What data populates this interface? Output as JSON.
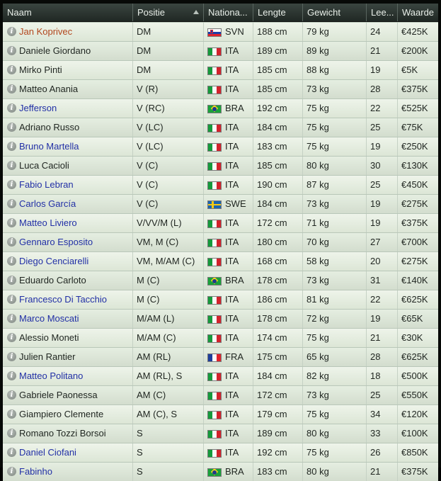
{
  "columns": [
    "Naam",
    "Positie",
    "Nationa...",
    "Lengte",
    "Gewicht",
    "Lee...",
    "Waarde"
  ],
  "sort_column": "Positie",
  "rows": [
    {
      "name": "Jan Koprivec",
      "pos": "DM",
      "flag": "svn",
      "nat": "SVN",
      "len": "188 cm",
      "wt": "79 kg",
      "age": "24",
      "val": "€425K",
      "style": "sel"
    },
    {
      "name": "Daniele Giordano",
      "pos": "DM",
      "flag": "ita",
      "nat": "ITA",
      "len": "189 cm",
      "wt": "89 kg",
      "age": "21",
      "val": "€200K",
      "style": "plain"
    },
    {
      "name": "Mirko Pinti",
      "pos": "DM",
      "flag": "ita",
      "nat": "ITA",
      "len": "185 cm",
      "wt": "88 kg",
      "age": "19",
      "val": "€5K",
      "style": "plain"
    },
    {
      "name": "Matteo Anania",
      "pos": "V (R)",
      "flag": "ita",
      "nat": "ITA",
      "len": "185 cm",
      "wt": "73 kg",
      "age": "28",
      "val": "€375K",
      "style": "plain"
    },
    {
      "name": "Jefferson",
      "pos": "V (RC)",
      "flag": "bra",
      "nat": "BRA",
      "len": "192 cm",
      "wt": "75 kg",
      "age": "22",
      "val": "€525K",
      "style": "link"
    },
    {
      "name": "Adriano Russo",
      "pos": "V (LC)",
      "flag": "ita",
      "nat": "ITA",
      "len": "184 cm",
      "wt": "75 kg",
      "age": "25",
      "val": "€75K",
      "style": "plain"
    },
    {
      "name": "Bruno Martella",
      "pos": "V (LC)",
      "flag": "ita",
      "nat": "ITA",
      "len": "183 cm",
      "wt": "75 kg",
      "age": "19",
      "val": "€250K",
      "style": "link"
    },
    {
      "name": "Luca Cacioli",
      "pos": "V (C)",
      "flag": "ita",
      "nat": "ITA",
      "len": "185 cm",
      "wt": "80 kg",
      "age": "30",
      "val": "€130K",
      "style": "plain"
    },
    {
      "name": "Fabio Lebran",
      "pos": "V (C)",
      "flag": "ita",
      "nat": "ITA",
      "len": "190 cm",
      "wt": "87 kg",
      "age": "25",
      "val": "€450K",
      "style": "link"
    },
    {
      "name": "Carlos García",
      "pos": "V (C)",
      "flag": "swe",
      "nat": "SWE",
      "len": "184 cm",
      "wt": "73 kg",
      "age": "19",
      "val": "€275K",
      "style": "link"
    },
    {
      "name": "Matteo Liviero",
      "pos": "V/VV/M (L)",
      "flag": "ita",
      "nat": "ITA",
      "len": "172 cm",
      "wt": "71 kg",
      "age": "19",
      "val": "€375K",
      "style": "link"
    },
    {
      "name": "Gennaro Esposito",
      "pos": "VM, M (C)",
      "flag": "ita",
      "nat": "ITA",
      "len": "180 cm",
      "wt": "70 kg",
      "age": "27",
      "val": "€700K",
      "style": "link"
    },
    {
      "name": "Diego Cenciarelli",
      "pos": "VM, M/AM (C)",
      "flag": "ita",
      "nat": "ITA",
      "len": "168 cm",
      "wt": "58 kg",
      "age": "20",
      "val": "€275K",
      "style": "link"
    },
    {
      "name": "Eduardo Carloto",
      "pos": "M (C)",
      "flag": "bra",
      "nat": "BRA",
      "len": "178 cm",
      "wt": "73 kg",
      "age": "31",
      "val": "€140K",
      "style": "plain"
    },
    {
      "name": "Francesco Di Tacchio",
      "pos": "M (C)",
      "flag": "ita",
      "nat": "ITA",
      "len": "186 cm",
      "wt": "81 kg",
      "age": "22",
      "val": "€625K",
      "style": "link"
    },
    {
      "name": "Marco Moscati",
      "pos": "M/AM (L)",
      "flag": "ita",
      "nat": "ITA",
      "len": "178 cm",
      "wt": "72 kg",
      "age": "19",
      "val": "€65K",
      "style": "link"
    },
    {
      "name": "Alessio Moneti",
      "pos": "M/AM (C)",
      "flag": "ita",
      "nat": "ITA",
      "len": "174 cm",
      "wt": "75 kg",
      "age": "21",
      "val": "€30K",
      "style": "plain"
    },
    {
      "name": "Julien Rantier",
      "pos": "AM (RL)",
      "flag": "fra",
      "nat": "FRA",
      "len": "175 cm",
      "wt": "65 kg",
      "age": "28",
      "val": "€625K",
      "style": "plain"
    },
    {
      "name": "Matteo Politano",
      "pos": "AM (RL), S",
      "flag": "ita",
      "nat": "ITA",
      "len": "184 cm",
      "wt": "82 kg",
      "age": "18",
      "val": "€500K",
      "style": "link"
    },
    {
      "name": "Gabriele Paonessa",
      "pos": "AM (C)",
      "flag": "ita",
      "nat": "ITA",
      "len": "172 cm",
      "wt": "73 kg",
      "age": "25",
      "val": "€550K",
      "style": "plain"
    },
    {
      "name": "Giampiero Clemente",
      "pos": "AM (C), S",
      "flag": "ita",
      "nat": "ITA",
      "len": "179 cm",
      "wt": "75 kg",
      "age": "34",
      "val": "€120K",
      "style": "plain"
    },
    {
      "name": "Romano Tozzi Borsoi",
      "pos": "S",
      "flag": "ita",
      "nat": "ITA",
      "len": "189 cm",
      "wt": "80 kg",
      "age": "33",
      "val": "€100K",
      "style": "plain"
    },
    {
      "name": "Daniel Ciofani",
      "pos": "S",
      "flag": "ita",
      "nat": "ITA",
      "len": "192 cm",
      "wt": "75 kg",
      "age": "26",
      "val": "€850K",
      "style": "link"
    },
    {
      "name": "Fabinho",
      "pos": "S",
      "flag": "bra",
      "nat": "BRA",
      "len": "183 cm",
      "wt": "80 kg",
      "age": "21",
      "val": "€375K",
      "style": "link"
    }
  ]
}
